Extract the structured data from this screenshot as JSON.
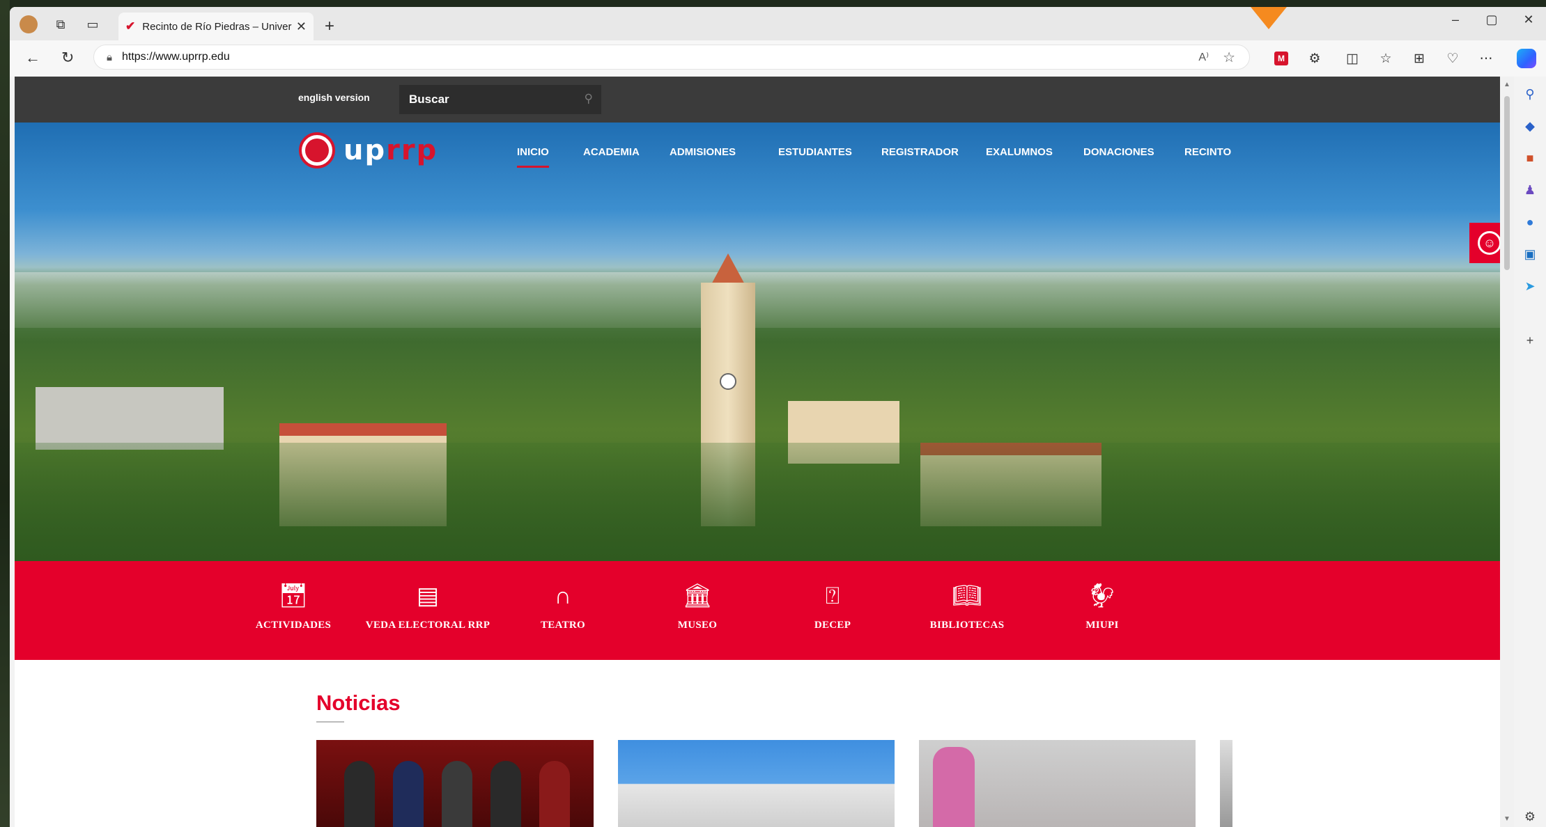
{
  "browser": {
    "tab_title": "Recinto de Río Piedras – Universi",
    "url": "https://www.uprrp.edu",
    "read_aloud": "A⁾",
    "window_controls": {
      "minimize": "–",
      "maximize": "▢",
      "close": "✕"
    },
    "new_tab": "+",
    "tab_close": "✕"
  },
  "site": {
    "english_version": "english version",
    "search_placeholder": "Buscar",
    "logo_left": "up",
    "logo_right": "rp",
    "logo_mid": "r",
    "nav": [
      {
        "label": "INICIO",
        "active": true
      },
      {
        "label": "ACADEMIA"
      },
      {
        "label": "ADMISIONES"
      },
      {
        "label": "ESTUDIANTES"
      },
      {
        "label": "REGISTRADOR"
      },
      {
        "label": "EXALUMNOS"
      },
      {
        "label": "DONACIONES"
      },
      {
        "label": "RECINTO"
      }
    ],
    "quick_links": [
      {
        "label": "ACTIVIDADES",
        "icon": "calendar-icon"
      },
      {
        "label": "VEDA ELECTORAL RRP",
        "icon": "list-icon"
      },
      {
        "label": "TEATRO",
        "icon": "arch-icon"
      },
      {
        "label": "MUSEO",
        "icon": "column-icon"
      },
      {
        "label": "DECEP",
        "icon": "presenter-icon"
      },
      {
        "label": "BIBLIOTECAS",
        "icon": "reader-icon"
      },
      {
        "label": "MIUPI",
        "icon": "rooster-icon"
      }
    ],
    "news_heading": "Noticias"
  },
  "colors": {
    "brand_red": "#e4002b",
    "topbar": "#3b3b3b"
  }
}
